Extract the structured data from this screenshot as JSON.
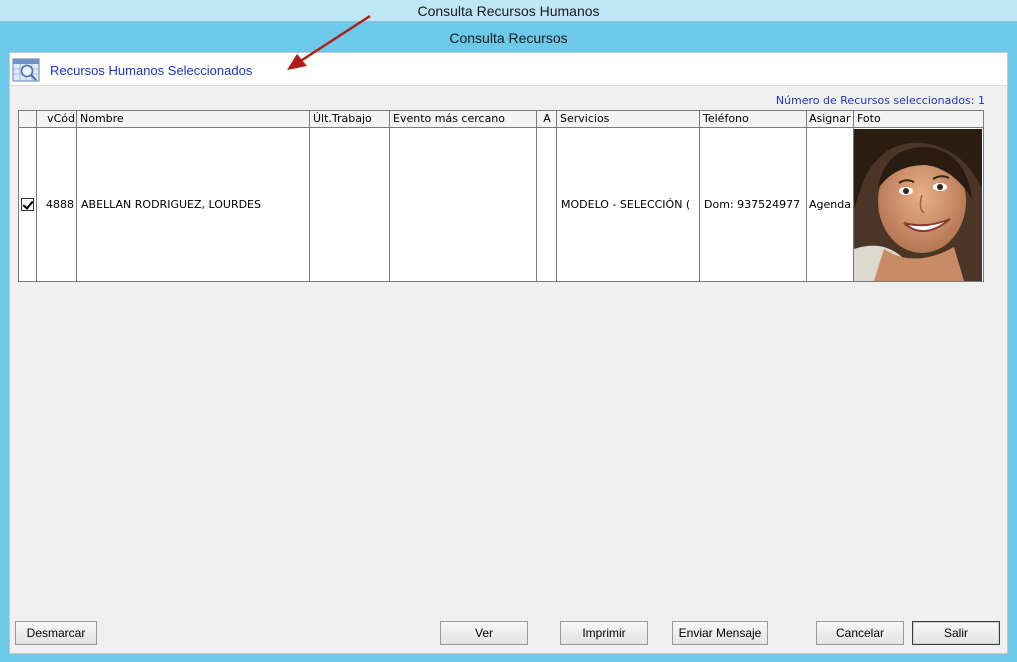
{
  "window": {
    "outer_title": "Consulta Recursos Humanos",
    "inner_title": "Consulta Recursos"
  },
  "header": {
    "icon": "search-calendar-icon",
    "title": "Recursos Humanos Seleccionados"
  },
  "count_label": "Número de Recursos seleccionados: 1",
  "table": {
    "columns": [
      "",
      "vCód",
      "Nombre",
      "Últ.Trabajo",
      "Evento más cercano",
      "A",
      "Servicios",
      "Teléfono",
      "Asignar",
      "Foto"
    ],
    "rows": [
      {
        "checked": true,
        "code": "4888",
        "name": "ABELLAN RODRIGUEZ, LOURDES",
        "last_job": "",
        "nearest_event": "",
        "a": "",
        "services": "MODELO - SELECCIÓN (",
        "phone": "Dom: 937524977",
        "assign": "Agenda",
        "photo": "portrait-photo"
      }
    ]
  },
  "buttons": {
    "unmark": "Desmarcar",
    "view": "Ver",
    "print": "Imprimir",
    "send_message": "Enviar Mensaje",
    "cancel": "Cancelar",
    "exit": "Salir"
  },
  "colors": {
    "frame": "#6cc9ea",
    "accent_text": "#1c35c8",
    "annotation_arrow": "#b31b1b"
  }
}
